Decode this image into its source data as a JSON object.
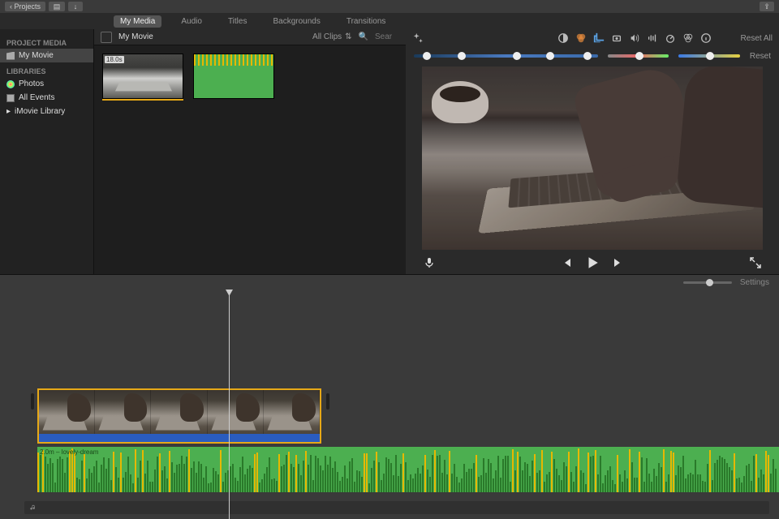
{
  "topbar": {
    "back_label": "Projects"
  },
  "tabs": {
    "items": [
      {
        "label": "My Media",
        "active": true
      },
      {
        "label": "Audio",
        "active": false
      },
      {
        "label": "Titles",
        "active": false
      },
      {
        "label": "Backgrounds",
        "active": false
      },
      {
        "label": "Transitions",
        "active": false
      }
    ]
  },
  "sidebar": {
    "heading1": "PROJECT MEDIA",
    "project_name": "My Movie",
    "heading2": "LIBRARIES",
    "items": [
      {
        "label": "Photos"
      },
      {
        "label": "All Events"
      },
      {
        "label": "iMovie Library"
      }
    ]
  },
  "browser": {
    "title": "My Movie",
    "filter_label": "All Clips",
    "search_placeholder": "Sear",
    "clips": [
      {
        "type": "video",
        "duration_label": "18.0s"
      },
      {
        "type": "audio"
      }
    ]
  },
  "viewer": {
    "reset_all": "Reset All",
    "reset": "Reset"
  },
  "timeline": {
    "settings_label": "Settings",
    "audio_clip_label": "2.0m – lovely-dream"
  }
}
